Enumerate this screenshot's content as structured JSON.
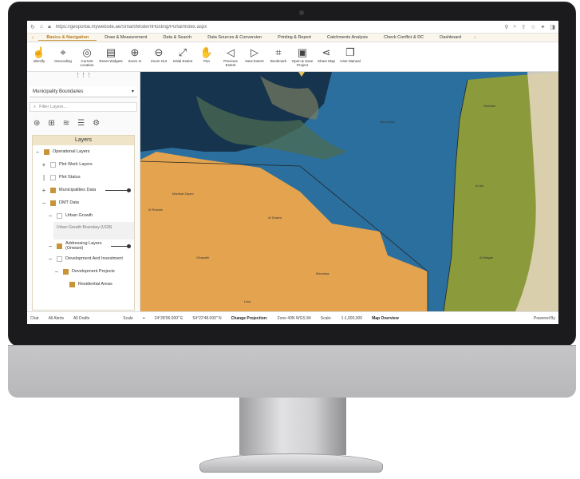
{
  "browser": {
    "url": "https://geoportal.mywebsite.ae/Smart/ModernHosting/Portal/Index.aspx"
  },
  "tabs": [
    {
      "label": "Basics & Navigation",
      "active": true
    },
    {
      "label": "Draw & Measurement"
    },
    {
      "label": "Data & Search"
    },
    {
      "label": "Data Sources & Conversion"
    },
    {
      "label": "Printing & Report"
    },
    {
      "label": "Catchments Analysis"
    },
    {
      "label": "Check Conflict & DC"
    },
    {
      "label": "Dashboard"
    }
  ],
  "toolbar": [
    {
      "label": "Identify",
      "icon": "pointer-icon"
    },
    {
      "label": "Geocoding",
      "icon": "crosshair-icon"
    },
    {
      "label": "Current Location",
      "icon": "location-icon"
    },
    {
      "label": "Reset Widgets",
      "icon": "document-icon"
    },
    {
      "label": "Zoom In",
      "icon": "zoom-in-icon"
    },
    {
      "label": "Zoom Out",
      "icon": "zoom-out-icon"
    },
    {
      "label": "Initial Extent",
      "icon": "extent-icon"
    },
    {
      "label": "Pan",
      "icon": "hand-icon"
    },
    {
      "label": "Previous Extent",
      "icon": "back-icon"
    },
    {
      "label": "Next Extent",
      "icon": "next-icon"
    },
    {
      "label": "Bookmark",
      "icon": "bookmark-icon"
    },
    {
      "label": "Open & Save Project",
      "icon": "folder-icon"
    },
    {
      "label": "Share Map",
      "icon": "share-icon"
    },
    {
      "label": "User Manual",
      "icon": "book-icon"
    }
  ],
  "sidebar": {
    "select_value": "Municipality Boundaries",
    "filter_placeholder": "Filter Layers...",
    "layers_title": "Layers",
    "layers": [
      {
        "label": "Operational Layers",
        "checked": true,
        "level": 0,
        "expander": "−"
      },
      {
        "label": "Plot Work Layers",
        "checked": false,
        "level": 1,
        "expander": "+"
      },
      {
        "label": "Plot Status",
        "checked": false,
        "level": 1,
        "expander": "|"
      },
      {
        "label": "Municipalities Data",
        "checked": true,
        "level": 1,
        "expander": "+",
        "slider": true
      },
      {
        "label": "DMT Data",
        "checked": true,
        "level": 1,
        "expander": "−"
      },
      {
        "label": "Urban Growth",
        "checked": false,
        "level": 2,
        "expander": "−"
      }
    ],
    "urban_growth_box": "Urban Growth Boundary (UGB)",
    "layers2": [
      {
        "label": "Addressing Layers (Onwani)",
        "checked": true,
        "level": 2,
        "expander": "−",
        "slider": true
      },
      {
        "label": "Development And Investment",
        "checked": false,
        "level": 2,
        "expander": "−"
      },
      {
        "label": "Development Projects",
        "checked": true,
        "level": 3,
        "expander": "−"
      },
      {
        "label": "Residential Areas",
        "checked": true,
        "level": 4,
        "expander": ""
      }
    ]
  },
  "status": {
    "left_tabs": [
      "Chat",
      "All Alerts",
      "All Drafts"
    ],
    "scale_label": "Scale",
    "coord_x": "24°28'06.000\" E",
    "coord_y": "54°22'48.000\" N",
    "projection_label": "Change Projection:",
    "projection_value": "Zone 40N WGS 84",
    "scale_prefix": "Scale:",
    "scale_value": "1:1,000,000",
    "overview_label": "Map Overview",
    "powered": "Powered By"
  },
  "map_labels": [
    "Abu Dhabi",
    "Al Dhafra",
    "Madinat Zayed",
    "Al Ruwais",
    "Al Ain",
    "Liwa",
    "Ghayathi",
    "Mezairaa",
    "Sweihan",
    "Al Wagan"
  ]
}
